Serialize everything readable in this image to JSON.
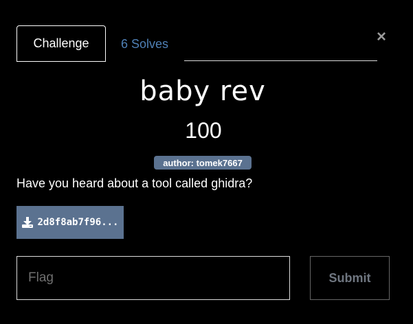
{
  "tabs": {
    "challenge": "Challenge",
    "solves": "6 Solves"
  },
  "close_icon": "×",
  "challenge": {
    "name": "baby rev",
    "value": "100",
    "author_badge": "author: tomek7667",
    "description": "Have you heard about a tool called ghidra?",
    "file_label": "2d8f8ab7f96..."
  },
  "form": {
    "flag_placeholder": "Flag",
    "submit_label": "Submit"
  },
  "colors": {
    "accent": "#5b7290",
    "link": "#4f80b6",
    "background": "#000000"
  }
}
